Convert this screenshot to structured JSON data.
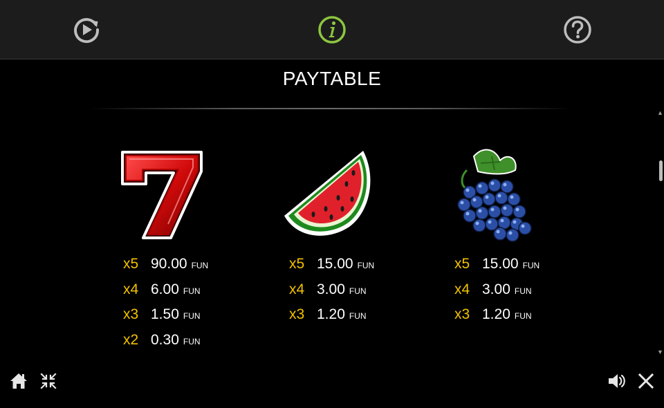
{
  "topbar": {
    "tabs": [
      {
        "icon": "replay-icon",
        "color": "#bdbdbd"
      },
      {
        "icon": "info-icon",
        "color": "#8cc63f",
        "active": true
      },
      {
        "icon": "help-icon",
        "color": "#bdbdbd"
      }
    ]
  },
  "title": "PAYTABLE",
  "colors": {
    "multiplier": "#f2c200",
    "amount": "#ffffff",
    "background": "#000000",
    "topbar": "#1c1c1c"
  },
  "symbols": [
    {
      "icon": "seven-symbol",
      "pays": [
        {
          "mult": "x5",
          "amount": "90.00",
          "currency": "FUN"
        },
        {
          "mult": "x4",
          "amount": "6.00",
          "currency": "FUN"
        },
        {
          "mult": "x3",
          "amount": "1.50",
          "currency": "FUN"
        },
        {
          "mult": "x2",
          "amount": "0.30",
          "currency": "FUN"
        }
      ]
    },
    {
      "icon": "watermelon-symbol",
      "pays": [
        {
          "mult": "x5",
          "amount": "15.00",
          "currency": "FUN"
        },
        {
          "mult": "x4",
          "amount": "3.00",
          "currency": "FUN"
        },
        {
          "mult": "x3",
          "amount": "1.20",
          "currency": "FUN"
        }
      ]
    },
    {
      "icon": "grapes-symbol",
      "pays": [
        {
          "mult": "x5",
          "amount": "15.00",
          "currency": "FUN"
        },
        {
          "mult": "x4",
          "amount": "3.00",
          "currency": "FUN"
        },
        {
          "mult": "x3",
          "amount": "1.20",
          "currency": "FUN"
        }
      ]
    }
  ],
  "scrollbar": {
    "up": "▲",
    "down": "▼"
  },
  "bottom": {
    "left": [
      "home-icon",
      "minimize-icon"
    ],
    "right": [
      "sound-icon",
      "close-icon"
    ]
  }
}
